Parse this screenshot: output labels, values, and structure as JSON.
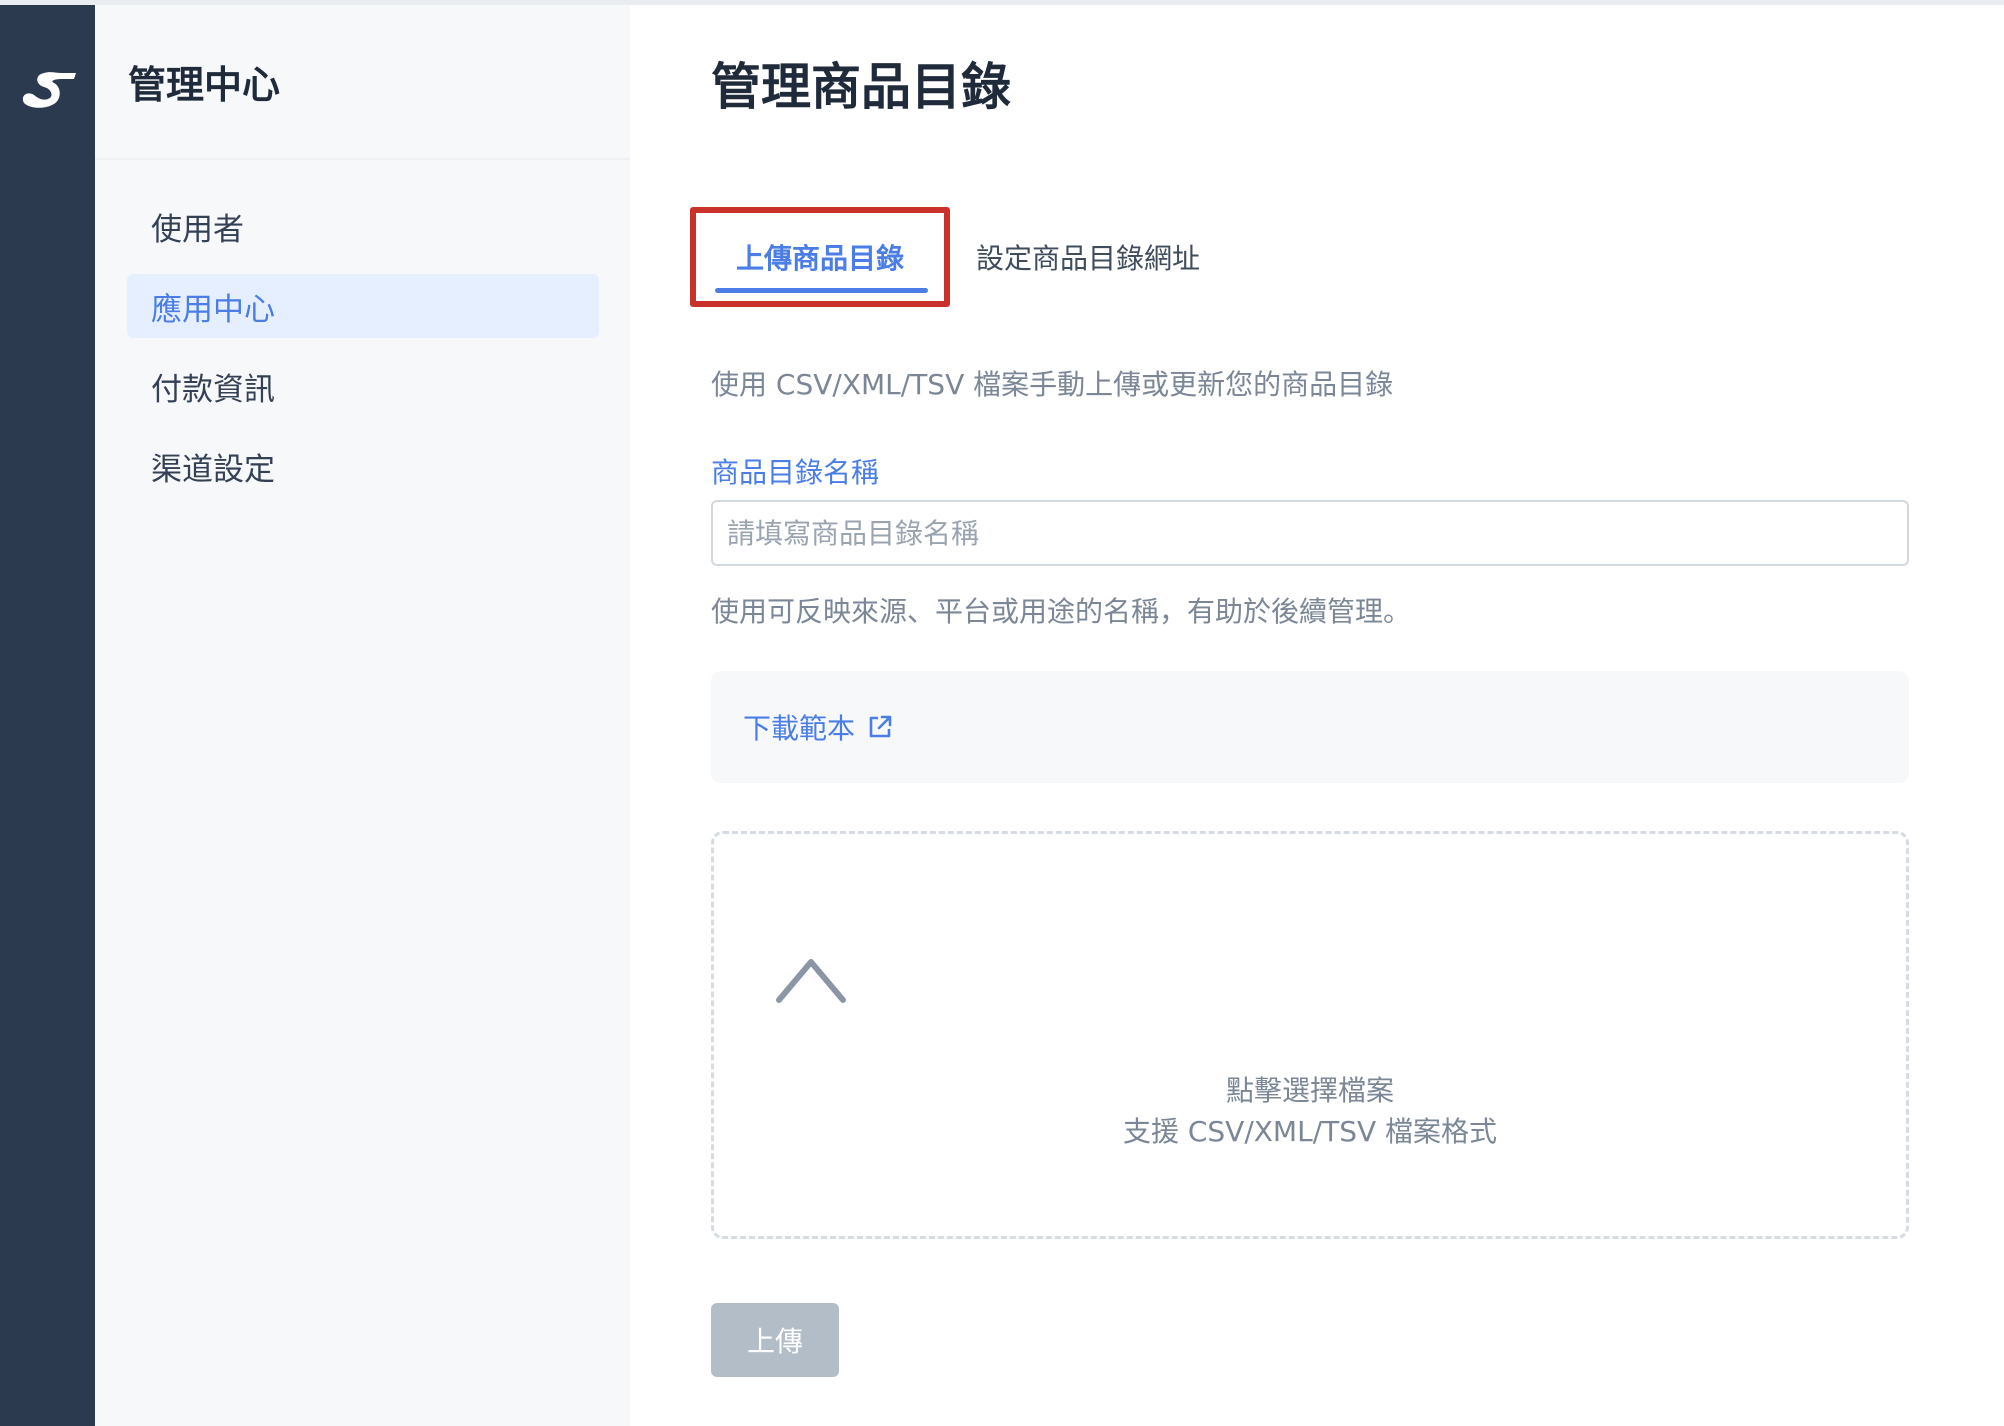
{
  "sidebar": {
    "title": "管理中心",
    "items": [
      {
        "label": "使用者"
      },
      {
        "label": "應用中心",
        "active": true
      },
      {
        "label": "付款資訊"
      },
      {
        "label": "渠道設定"
      }
    ]
  },
  "main": {
    "title": "管理商品目錄",
    "tabs": [
      {
        "label": "上傳商品目錄",
        "active": true
      },
      {
        "label": "設定商品目錄網址"
      }
    ],
    "description": "使用 CSV/XML/TSV 檔案手動上傳或更新您的商品目錄",
    "catalog_name": {
      "label": "商品目錄名稱",
      "placeholder": "請填寫商品目錄名稱",
      "value": "",
      "help": "使用可反映來源、平台或用途的名稱，有助於後續管理。"
    },
    "download_template": {
      "label": "下載範本",
      "icon": "external-link-icon"
    },
    "dropzone": {
      "icon": "chevron-up-icon",
      "line1": "點擊選擇檔案",
      "line2": "支援 CSV/XML/TSV 檔案格式"
    },
    "upload_button": {
      "label": "上傳"
    }
  },
  "colors": {
    "rail": "#2b3a4f",
    "accent": "#4a7ee6",
    "highlight_border": "#c8322b",
    "disabled_button": "#b3bdc8"
  }
}
